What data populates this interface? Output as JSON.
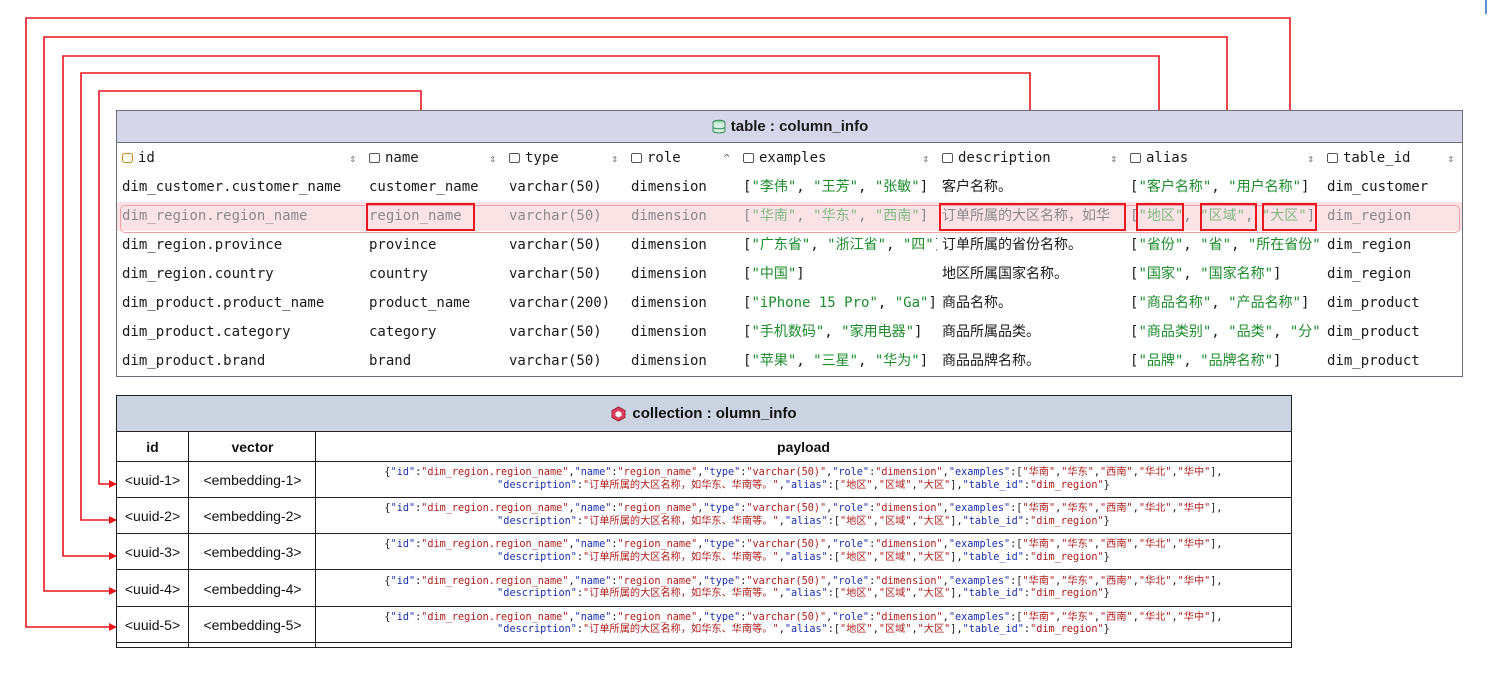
{
  "table": {
    "title": "table : column_info",
    "icon": "database-icon",
    "columns": [
      {
        "label": "id",
        "icon": "key-column-icon",
        "sort": "⇕"
      },
      {
        "label": "name",
        "icon": "column-icon",
        "sort": "⇕"
      },
      {
        "label": "type",
        "icon": "column-icon",
        "sort": "⇕"
      },
      {
        "label": "role",
        "icon": "column-icon",
        "sort": "^"
      },
      {
        "label": "examples",
        "icon": "column-icon",
        "sort": "⇕"
      },
      {
        "label": "description",
        "icon": "column-icon",
        "sort": "⇕"
      },
      {
        "label": "alias",
        "icon": "column-icon",
        "sort": "⇕"
      },
      {
        "label": "table_id",
        "icon": "column-icon",
        "sort": "⇕"
      }
    ],
    "rows": [
      {
        "id": "dim_customer.customer_name",
        "name": "customer_name",
        "type": "varchar(50)",
        "role": "dimension",
        "examples": [
          "李伟",
          "王芳",
          "张敏"
        ],
        "description": "客户名称。",
        "alias": [
          "客户名称",
          "用户名称"
        ],
        "table_id": "dim_customer"
      },
      {
        "id": "dim_region.region_name",
        "name": "region_name",
        "type": "varchar(50)",
        "role": "dimension",
        "examples": [
          "华南",
          "华东",
          "西南"
        ],
        "description": "订单所属的大区名称，如华",
        "alias": [
          "地区",
          "区域",
          "大区"
        ],
        "table_id": "dim_region",
        "selected": true
      },
      {
        "id": "dim_region.province",
        "name": "province",
        "type": "varchar(50)",
        "role": "dimension",
        "examples": [
          "广东省",
          "浙江省",
          "四"
        ],
        "description": "订单所属的省份名称。",
        "alias": [
          "省份",
          "省",
          "所在省份"
        ],
        "table_id": "dim_region"
      },
      {
        "id": "dim_region.country",
        "name": "country",
        "type": "varchar(50)",
        "role": "dimension",
        "examples": [
          "中国"
        ],
        "description": "地区所属国家名称。",
        "alias": [
          "国家",
          "国家名称"
        ],
        "table_id": "dim_region"
      },
      {
        "id": "dim_product.product_name",
        "name": "product_name",
        "type": "varchar(200)",
        "role": "dimension",
        "examples": [
          "iPhone 15 Pro",
          "Ga"
        ],
        "description": "商品名称。",
        "alias": [
          "商品名称",
          "产品名称"
        ],
        "table_id": "dim_product"
      },
      {
        "id": "dim_product.category",
        "name": "category",
        "type": "varchar(50)",
        "role": "dimension",
        "examples": [
          "手机数码",
          "家用电器"
        ],
        "description": "商品所属品类。",
        "alias": [
          "商品类别",
          "品类",
          "分"
        ],
        "table_id": "dim_product"
      },
      {
        "id": "dim_product.brand",
        "name": "brand",
        "type": "varchar(50)",
        "role": "dimension",
        "examples": [
          "苹果",
          "三星",
          "华为"
        ],
        "description": "商品品牌名称。",
        "alias": [
          "品牌",
          "品牌名称"
        ],
        "table_id": "dim_product"
      }
    ]
  },
  "collection": {
    "title": "collection : olumn_info",
    "icon": "collection-icon",
    "headers": [
      "id",
      "vector",
      "payload"
    ],
    "rows": [
      {
        "id": "<uuid-1>",
        "vector": "<embedding-1>"
      },
      {
        "id": "<uuid-2>",
        "vector": "<embedding-2>"
      },
      {
        "id": "<uuid-3>",
        "vector": "<embedding-3>"
      },
      {
        "id": "<uuid-4>",
        "vector": "<embedding-4>"
      },
      {
        "id": "<uuid-5>",
        "vector": "<embedding-5>"
      }
    ],
    "payload": {
      "id": "dim_region.region_name",
      "name": "region_name",
      "type": "varchar(50)",
      "role": "dimension",
      "examples": [
        "华南",
        "华东",
        "西南",
        "华北",
        "华中"
      ],
      "description": "订单所属的大区名称，如华东、华南等。",
      "alias": [
        "地区",
        "区域",
        "大区"
      ],
      "table_id": "dim_region"
    }
  },
  "colors": {
    "arrow": "#e8161e",
    "table_title_bg": "#d6d6ea",
    "selected_row_bg": "#fbe3e5",
    "collection_title_bg": "#ccd4e2",
    "string_green": "#1c8c2c",
    "payload_key": "#1a2fb0",
    "payload_value": "#b01c1c"
  }
}
